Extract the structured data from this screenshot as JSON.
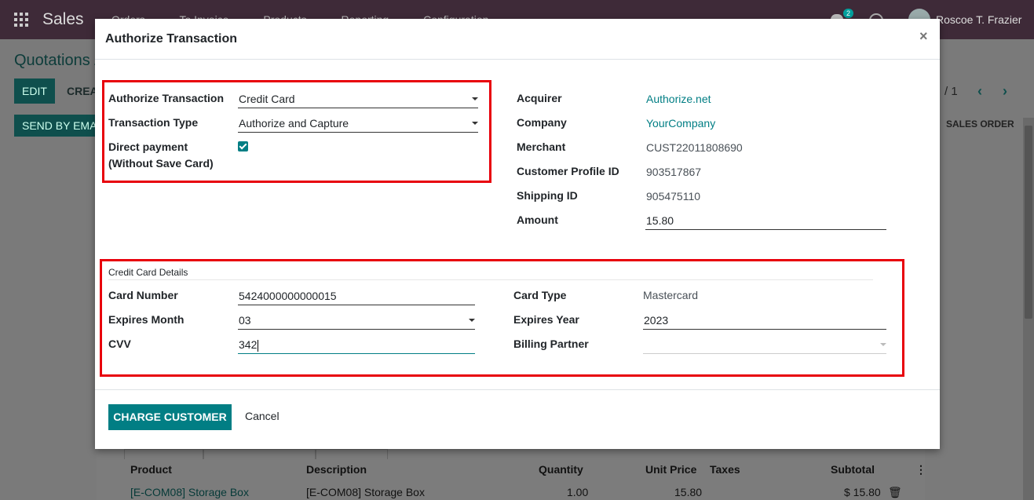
{
  "navbar": {
    "app_name": "Sales",
    "menu": [
      "Orders",
      "To Invoice",
      "Products",
      "Reporting",
      "Configuration"
    ],
    "chat_count": "2",
    "user_name": "Roscoe T. Frazier"
  },
  "page": {
    "breadcrumb": "Quotations /",
    "edit_label": "EDIT",
    "create_label": "CREA",
    "send_email_label": "SEND BY EMA",
    "pager": "/ 1",
    "status_label": "SALES ORDER"
  },
  "table": {
    "headers": [
      "Product",
      "Description",
      "Quantity",
      "Unit Price",
      "Taxes",
      "Subtotal"
    ],
    "row": {
      "product": "[E-COM08] Storage Box",
      "description": "[E-COM08] Storage Box",
      "quantity": "1.00",
      "unit_price": "15.80",
      "subtotal": "$ 15.80"
    }
  },
  "modal": {
    "title": "Authorize Transaction",
    "close_glyph": "×",
    "left": {
      "authorize_transaction_label": "Authorize Transaction",
      "authorize_transaction_value": "Credit Card",
      "transaction_type_label": "Transaction Type",
      "transaction_type_value": "Authorize and Capture",
      "direct_payment_label_1": "Direct payment",
      "direct_payment_label_2": "(Without Save Card)",
      "direct_payment_checked": true
    },
    "right": {
      "acquirer_label": "Acquirer",
      "acquirer_value": "Authorize.net",
      "company_label": "Company",
      "company_value": "YourCompany",
      "merchant_label": "Merchant",
      "merchant_value": "CUST22011808690",
      "customer_profile_label": "Customer Profile ID",
      "customer_profile_value": "903517867",
      "shipping_label": "Shipping ID",
      "shipping_value": "905475110",
      "amount_label": "Amount",
      "amount_value": "15.80"
    },
    "card": {
      "section_title": "Credit Card Details",
      "card_number_label": "Card Number",
      "card_number_value": "5424000000000015",
      "expires_month_label": "Expires Month",
      "expires_month_value": "03",
      "cvv_label": "CVV",
      "cvv_value": "342",
      "card_type_label": "Card Type",
      "card_type_value": "Mastercard",
      "expires_year_label": "Expires Year",
      "expires_year_value": "2023",
      "billing_partner_label": "Billing Partner",
      "billing_partner_value": ""
    },
    "footer": {
      "charge_label": "CHARGE CUSTOMER",
      "cancel_label": "Cancel"
    }
  },
  "colors": {
    "accent": "#017e84",
    "highlight_box": "#e8000b",
    "navbar": "#714b67"
  }
}
